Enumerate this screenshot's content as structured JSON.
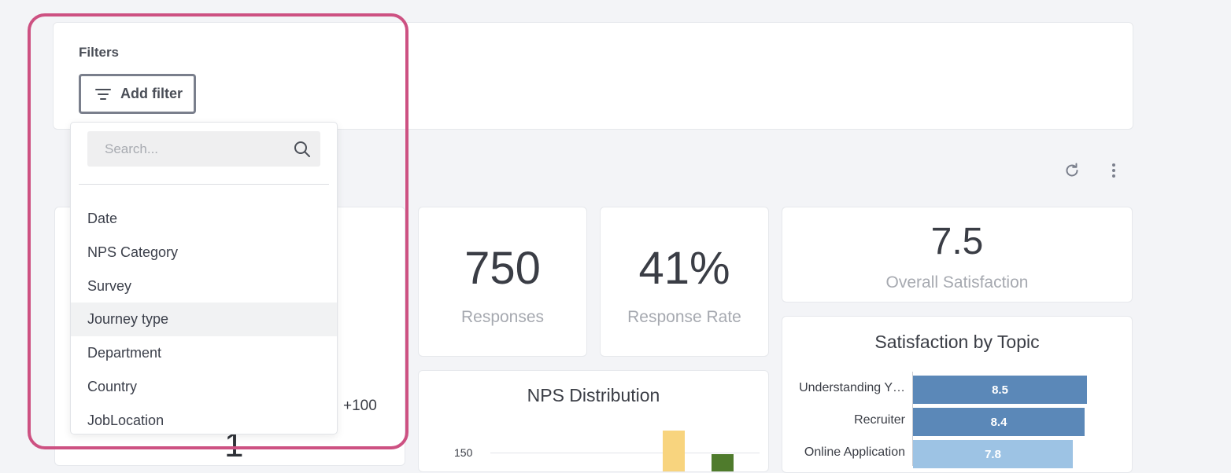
{
  "filters": {
    "title": "Filters",
    "add_filter_label": "Add filter"
  },
  "toolbar": {
    "refresh_icon": "refresh-icon",
    "more_icon": "more-vertical-icon"
  },
  "left_card": {
    "plus_label": "+100",
    "value": "1"
  },
  "kpis": {
    "responses": {
      "value": "750",
      "label": "Responses"
    },
    "response_rate": {
      "value": "41%",
      "label": "Response Rate"
    },
    "overall_satisfaction": {
      "value": "7.5",
      "label": "Overall Satisfaction"
    }
  },
  "nps_distribution": {
    "title": "NPS Distribution",
    "tick_label": "150"
  },
  "satisfaction_by_topic": {
    "title": "Satisfaction by Topic"
  },
  "chart_data": [
    {
      "type": "bar",
      "title": "Satisfaction by Topic",
      "orientation": "horizontal",
      "categories": [
        "Understanding Y…",
        "Recruiter",
        "Online Application"
      ],
      "values": [
        8.5,
        8.4,
        7.8
      ],
      "colors": [
        "#5b88b8",
        "#5b88b8",
        "#9dc3e4"
      ]
    },
    {
      "type": "bar",
      "title": "NPS Distribution",
      "yticks": [
        150
      ],
      "colors": [
        "#f8d47e",
        "#4f7b2c"
      ]
    }
  ],
  "dropdown": {
    "search_placeholder": "Search...",
    "items": [
      {
        "label": "Date"
      },
      {
        "label": "NPS Category"
      },
      {
        "label": "Survey"
      },
      {
        "label": "Journey type"
      },
      {
        "label": "Department"
      },
      {
        "label": "Country"
      },
      {
        "label": "JobLocation"
      }
    ],
    "hovered_index": 3
  },
  "colors": {
    "highlight": "#cd5182",
    "background": "#f3f4f7"
  }
}
